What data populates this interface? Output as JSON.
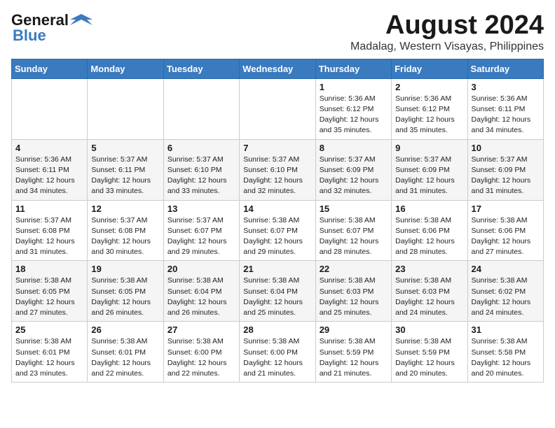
{
  "logo": {
    "general": "General",
    "blue": "Blue"
  },
  "title": "August 2024",
  "subtitle": "Madalag, Western Visayas, Philippines",
  "headers": [
    "Sunday",
    "Monday",
    "Tuesday",
    "Wednesday",
    "Thursday",
    "Friday",
    "Saturday"
  ],
  "weeks": [
    [
      {
        "day": "",
        "detail": ""
      },
      {
        "day": "",
        "detail": ""
      },
      {
        "day": "",
        "detail": ""
      },
      {
        "day": "",
        "detail": ""
      },
      {
        "day": "1",
        "detail": "Sunrise: 5:36 AM\nSunset: 6:12 PM\nDaylight: 12 hours\nand 35 minutes."
      },
      {
        "day": "2",
        "detail": "Sunrise: 5:36 AM\nSunset: 6:12 PM\nDaylight: 12 hours\nand 35 minutes."
      },
      {
        "day": "3",
        "detail": "Sunrise: 5:36 AM\nSunset: 6:11 PM\nDaylight: 12 hours\nand 34 minutes."
      }
    ],
    [
      {
        "day": "4",
        "detail": "Sunrise: 5:36 AM\nSunset: 6:11 PM\nDaylight: 12 hours\nand 34 minutes."
      },
      {
        "day": "5",
        "detail": "Sunrise: 5:37 AM\nSunset: 6:11 PM\nDaylight: 12 hours\nand 33 minutes."
      },
      {
        "day": "6",
        "detail": "Sunrise: 5:37 AM\nSunset: 6:10 PM\nDaylight: 12 hours\nand 33 minutes."
      },
      {
        "day": "7",
        "detail": "Sunrise: 5:37 AM\nSunset: 6:10 PM\nDaylight: 12 hours\nand 32 minutes."
      },
      {
        "day": "8",
        "detail": "Sunrise: 5:37 AM\nSunset: 6:09 PM\nDaylight: 12 hours\nand 32 minutes."
      },
      {
        "day": "9",
        "detail": "Sunrise: 5:37 AM\nSunset: 6:09 PM\nDaylight: 12 hours\nand 31 minutes."
      },
      {
        "day": "10",
        "detail": "Sunrise: 5:37 AM\nSunset: 6:09 PM\nDaylight: 12 hours\nand 31 minutes."
      }
    ],
    [
      {
        "day": "11",
        "detail": "Sunrise: 5:37 AM\nSunset: 6:08 PM\nDaylight: 12 hours\nand 31 minutes."
      },
      {
        "day": "12",
        "detail": "Sunrise: 5:37 AM\nSunset: 6:08 PM\nDaylight: 12 hours\nand 30 minutes."
      },
      {
        "day": "13",
        "detail": "Sunrise: 5:37 AM\nSunset: 6:07 PM\nDaylight: 12 hours\nand 29 minutes."
      },
      {
        "day": "14",
        "detail": "Sunrise: 5:38 AM\nSunset: 6:07 PM\nDaylight: 12 hours\nand 29 minutes."
      },
      {
        "day": "15",
        "detail": "Sunrise: 5:38 AM\nSunset: 6:07 PM\nDaylight: 12 hours\nand 28 minutes."
      },
      {
        "day": "16",
        "detail": "Sunrise: 5:38 AM\nSunset: 6:06 PM\nDaylight: 12 hours\nand 28 minutes."
      },
      {
        "day": "17",
        "detail": "Sunrise: 5:38 AM\nSunset: 6:06 PM\nDaylight: 12 hours\nand 27 minutes."
      }
    ],
    [
      {
        "day": "18",
        "detail": "Sunrise: 5:38 AM\nSunset: 6:05 PM\nDaylight: 12 hours\nand 27 minutes."
      },
      {
        "day": "19",
        "detail": "Sunrise: 5:38 AM\nSunset: 6:05 PM\nDaylight: 12 hours\nand 26 minutes."
      },
      {
        "day": "20",
        "detail": "Sunrise: 5:38 AM\nSunset: 6:04 PM\nDaylight: 12 hours\nand 26 minutes."
      },
      {
        "day": "21",
        "detail": "Sunrise: 5:38 AM\nSunset: 6:04 PM\nDaylight: 12 hours\nand 25 minutes."
      },
      {
        "day": "22",
        "detail": "Sunrise: 5:38 AM\nSunset: 6:03 PM\nDaylight: 12 hours\nand 25 minutes."
      },
      {
        "day": "23",
        "detail": "Sunrise: 5:38 AM\nSunset: 6:03 PM\nDaylight: 12 hours\nand 24 minutes."
      },
      {
        "day": "24",
        "detail": "Sunrise: 5:38 AM\nSunset: 6:02 PM\nDaylight: 12 hours\nand 24 minutes."
      }
    ],
    [
      {
        "day": "25",
        "detail": "Sunrise: 5:38 AM\nSunset: 6:01 PM\nDaylight: 12 hours\nand 23 minutes."
      },
      {
        "day": "26",
        "detail": "Sunrise: 5:38 AM\nSunset: 6:01 PM\nDaylight: 12 hours\nand 22 minutes."
      },
      {
        "day": "27",
        "detail": "Sunrise: 5:38 AM\nSunset: 6:00 PM\nDaylight: 12 hours\nand 22 minutes."
      },
      {
        "day": "28",
        "detail": "Sunrise: 5:38 AM\nSunset: 6:00 PM\nDaylight: 12 hours\nand 21 minutes."
      },
      {
        "day": "29",
        "detail": "Sunrise: 5:38 AM\nSunset: 5:59 PM\nDaylight: 12 hours\nand 21 minutes."
      },
      {
        "day": "30",
        "detail": "Sunrise: 5:38 AM\nSunset: 5:59 PM\nDaylight: 12 hours\nand 20 minutes."
      },
      {
        "day": "31",
        "detail": "Sunrise: 5:38 AM\nSunset: 5:58 PM\nDaylight: 12 hours\nand 20 minutes."
      }
    ]
  ]
}
